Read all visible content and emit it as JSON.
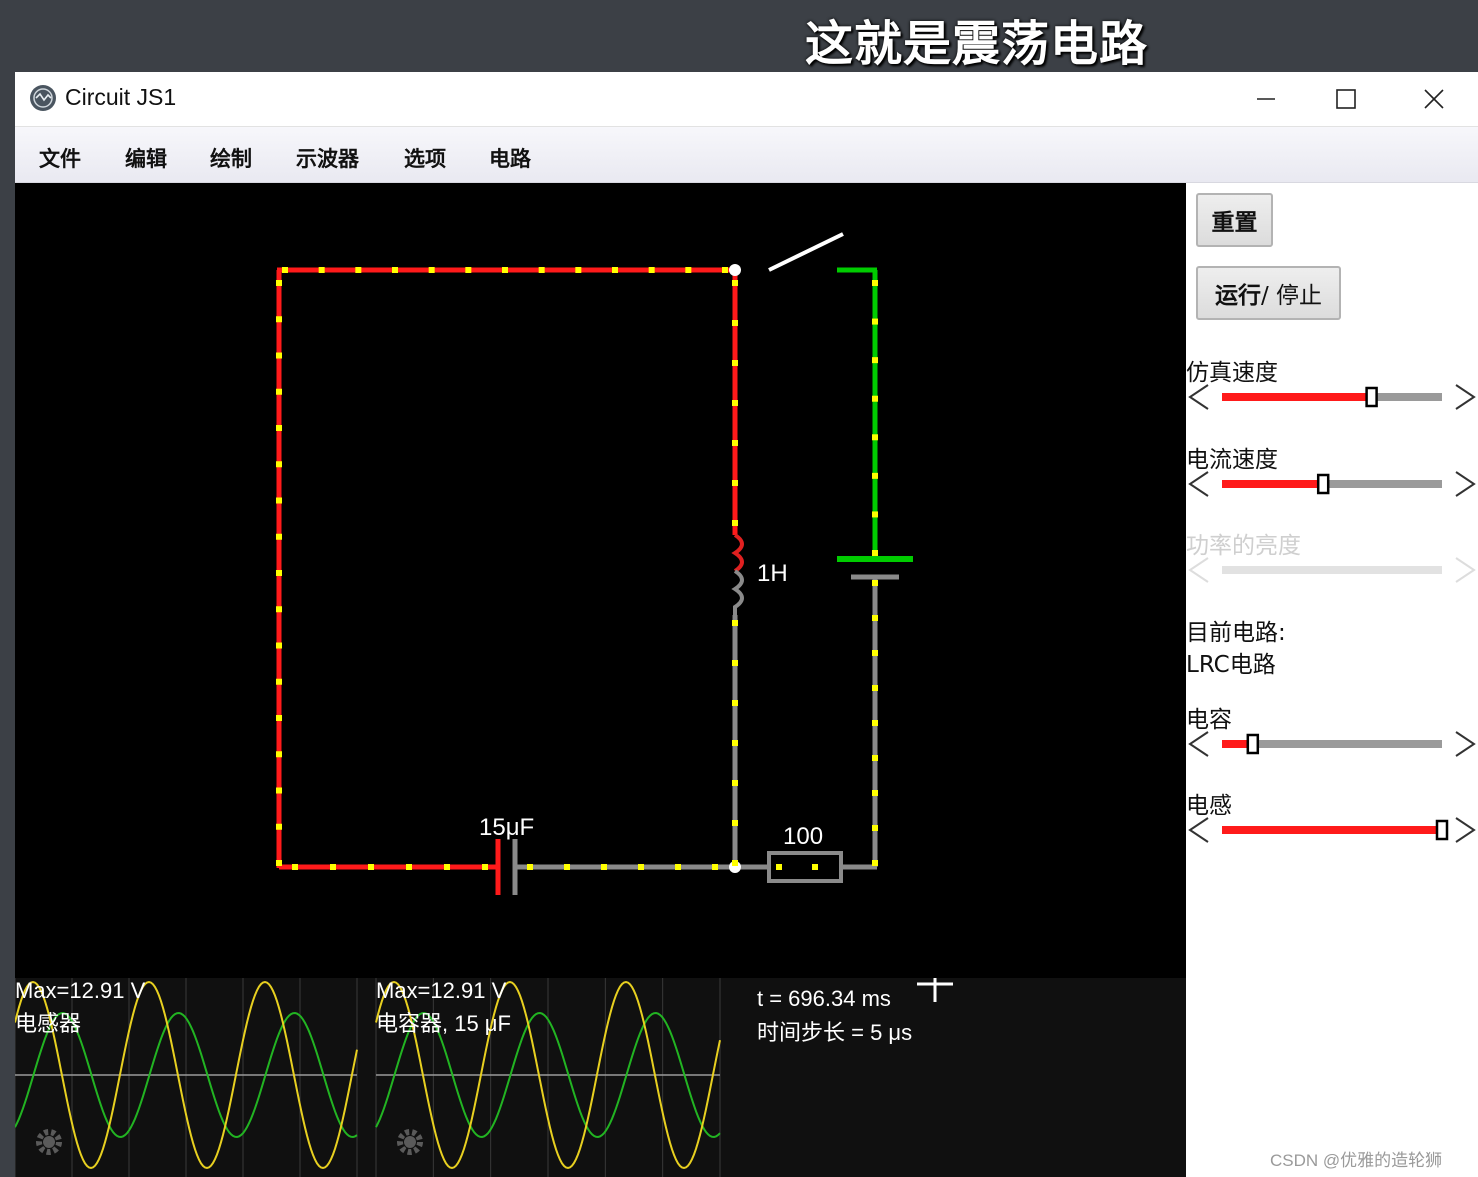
{
  "banner": {
    "text": "这就是震荡电路"
  },
  "window": {
    "title": "Circuit JS1"
  },
  "menu": [
    "文件",
    "编辑",
    "绘制",
    "示波器",
    "选项",
    "电路"
  ],
  "circuit": {
    "inductor_label": "1H",
    "capacitor_label": "15μF",
    "resistor_label": "100"
  },
  "scopes": [
    {
      "max": "Max=12.91 V",
      "name": "电感器"
    },
    {
      "max": "Max=12.91 V",
      "name": "电容器, 15 μF"
    }
  ],
  "sim_info": {
    "time": "t = 696.34 ms",
    "step": "时间步长 = 5 μs"
  },
  "sidebar": {
    "reset": "重置",
    "run_bold": "运行",
    "run_rest": " / 停止",
    "sliders": [
      {
        "label": "仿真速度",
        "value": 0.68,
        "enabled": true
      },
      {
        "label": "电流速度",
        "value": 0.46,
        "enabled": true
      },
      {
        "label": "功率的亮度",
        "value": 0.0,
        "enabled": false
      }
    ],
    "current_circuit_label": "目前电路:",
    "current_circuit_name": "LRC电路",
    "param_sliders": [
      {
        "label": "电容",
        "value": 0.14,
        "enabled": true
      },
      {
        "label": "电感",
        "value": 1.0,
        "enabled": true
      }
    ]
  },
  "watermark": "CSDN @优雅的造轮狮",
  "colors": {
    "wire_red": "#ff1a1a",
    "wire_green": "#00cc00",
    "wire_gray": "#8a8a8a",
    "current_dot": "#ffff00",
    "scope_yellow": "#e8d020",
    "scope_green": "#22b422",
    "slider_fill": "#ff1a1a",
    "slider_track": "#9a9a9a"
  }
}
